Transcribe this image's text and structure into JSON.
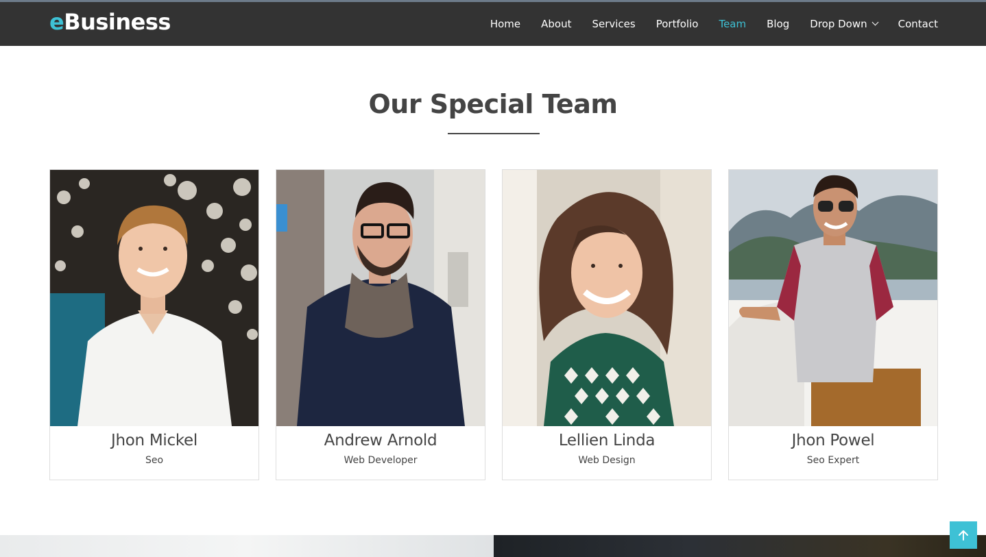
{
  "brand": {
    "accent_letter": "e",
    "rest": "Business",
    "accent_color": "#3ec1d5"
  },
  "nav": {
    "items": [
      {
        "label": "Home"
      },
      {
        "label": "About"
      },
      {
        "label": "Services"
      },
      {
        "label": "Portfolio"
      },
      {
        "label": "Team",
        "active": true
      },
      {
        "label": "Blog"
      },
      {
        "label": "Drop Down",
        "icon": "chevron-down-icon"
      },
      {
        "label": "Contact"
      }
    ]
  },
  "team": {
    "title": "Our Special Team",
    "members": [
      {
        "name": "Jhon Mickel",
        "role": "Seo"
      },
      {
        "name": "Andrew Arnold",
        "role": "Web Developer"
      },
      {
        "name": "Lellien Linda",
        "role": "Web Design"
      },
      {
        "name": "Jhon Powel",
        "role": "Seo Expert"
      }
    ]
  },
  "back_to_top": {
    "icon": "arrow-up-icon"
  }
}
